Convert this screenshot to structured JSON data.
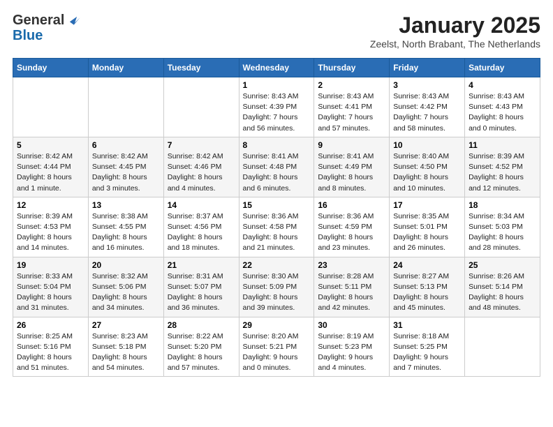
{
  "header": {
    "logo_line1": "General",
    "logo_line2": "Blue",
    "month": "January 2025",
    "location": "Zeelst, North Brabant, The Netherlands"
  },
  "weekdays": [
    "Sunday",
    "Monday",
    "Tuesday",
    "Wednesday",
    "Thursday",
    "Friday",
    "Saturday"
  ],
  "weeks": [
    [
      {
        "day": "",
        "info": ""
      },
      {
        "day": "",
        "info": ""
      },
      {
        "day": "",
        "info": ""
      },
      {
        "day": "1",
        "info": "Sunrise: 8:43 AM\nSunset: 4:39 PM\nDaylight: 7 hours\nand 56 minutes."
      },
      {
        "day": "2",
        "info": "Sunrise: 8:43 AM\nSunset: 4:41 PM\nDaylight: 7 hours\nand 57 minutes."
      },
      {
        "day": "3",
        "info": "Sunrise: 8:43 AM\nSunset: 4:42 PM\nDaylight: 7 hours\nand 58 minutes."
      },
      {
        "day": "4",
        "info": "Sunrise: 8:43 AM\nSunset: 4:43 PM\nDaylight: 8 hours\nand 0 minutes."
      }
    ],
    [
      {
        "day": "5",
        "info": "Sunrise: 8:42 AM\nSunset: 4:44 PM\nDaylight: 8 hours\nand 1 minute."
      },
      {
        "day": "6",
        "info": "Sunrise: 8:42 AM\nSunset: 4:45 PM\nDaylight: 8 hours\nand 3 minutes."
      },
      {
        "day": "7",
        "info": "Sunrise: 8:42 AM\nSunset: 4:46 PM\nDaylight: 8 hours\nand 4 minutes."
      },
      {
        "day": "8",
        "info": "Sunrise: 8:41 AM\nSunset: 4:48 PM\nDaylight: 8 hours\nand 6 minutes."
      },
      {
        "day": "9",
        "info": "Sunrise: 8:41 AM\nSunset: 4:49 PM\nDaylight: 8 hours\nand 8 minutes."
      },
      {
        "day": "10",
        "info": "Sunrise: 8:40 AM\nSunset: 4:50 PM\nDaylight: 8 hours\nand 10 minutes."
      },
      {
        "day": "11",
        "info": "Sunrise: 8:39 AM\nSunset: 4:52 PM\nDaylight: 8 hours\nand 12 minutes."
      }
    ],
    [
      {
        "day": "12",
        "info": "Sunrise: 8:39 AM\nSunset: 4:53 PM\nDaylight: 8 hours\nand 14 minutes."
      },
      {
        "day": "13",
        "info": "Sunrise: 8:38 AM\nSunset: 4:55 PM\nDaylight: 8 hours\nand 16 minutes."
      },
      {
        "day": "14",
        "info": "Sunrise: 8:37 AM\nSunset: 4:56 PM\nDaylight: 8 hours\nand 18 minutes."
      },
      {
        "day": "15",
        "info": "Sunrise: 8:36 AM\nSunset: 4:58 PM\nDaylight: 8 hours\nand 21 minutes."
      },
      {
        "day": "16",
        "info": "Sunrise: 8:36 AM\nSunset: 4:59 PM\nDaylight: 8 hours\nand 23 minutes."
      },
      {
        "day": "17",
        "info": "Sunrise: 8:35 AM\nSunset: 5:01 PM\nDaylight: 8 hours\nand 26 minutes."
      },
      {
        "day": "18",
        "info": "Sunrise: 8:34 AM\nSunset: 5:03 PM\nDaylight: 8 hours\nand 28 minutes."
      }
    ],
    [
      {
        "day": "19",
        "info": "Sunrise: 8:33 AM\nSunset: 5:04 PM\nDaylight: 8 hours\nand 31 minutes."
      },
      {
        "day": "20",
        "info": "Sunrise: 8:32 AM\nSunset: 5:06 PM\nDaylight: 8 hours\nand 34 minutes."
      },
      {
        "day": "21",
        "info": "Sunrise: 8:31 AM\nSunset: 5:07 PM\nDaylight: 8 hours\nand 36 minutes."
      },
      {
        "day": "22",
        "info": "Sunrise: 8:30 AM\nSunset: 5:09 PM\nDaylight: 8 hours\nand 39 minutes."
      },
      {
        "day": "23",
        "info": "Sunrise: 8:28 AM\nSunset: 5:11 PM\nDaylight: 8 hours\nand 42 minutes."
      },
      {
        "day": "24",
        "info": "Sunrise: 8:27 AM\nSunset: 5:13 PM\nDaylight: 8 hours\nand 45 minutes."
      },
      {
        "day": "25",
        "info": "Sunrise: 8:26 AM\nSunset: 5:14 PM\nDaylight: 8 hours\nand 48 minutes."
      }
    ],
    [
      {
        "day": "26",
        "info": "Sunrise: 8:25 AM\nSunset: 5:16 PM\nDaylight: 8 hours\nand 51 minutes."
      },
      {
        "day": "27",
        "info": "Sunrise: 8:23 AM\nSunset: 5:18 PM\nDaylight: 8 hours\nand 54 minutes."
      },
      {
        "day": "28",
        "info": "Sunrise: 8:22 AM\nSunset: 5:20 PM\nDaylight: 8 hours\nand 57 minutes."
      },
      {
        "day": "29",
        "info": "Sunrise: 8:20 AM\nSunset: 5:21 PM\nDaylight: 9 hours\nand 0 minutes."
      },
      {
        "day": "30",
        "info": "Sunrise: 8:19 AM\nSunset: 5:23 PM\nDaylight: 9 hours\nand 4 minutes."
      },
      {
        "day": "31",
        "info": "Sunrise: 8:18 AM\nSunset: 5:25 PM\nDaylight: 9 hours\nand 7 minutes."
      },
      {
        "day": "",
        "info": ""
      }
    ]
  ]
}
